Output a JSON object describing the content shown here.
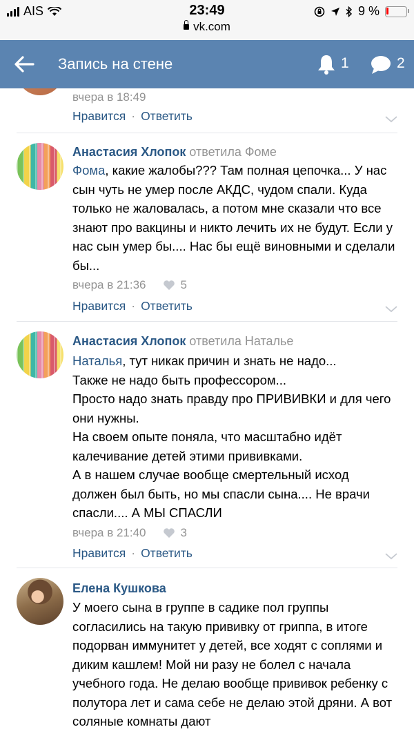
{
  "status": {
    "carrier": "AIS",
    "time": "23:49",
    "url": "vk.com",
    "battery": "9 %"
  },
  "header": {
    "title": "Запись на стене",
    "notifications_count": "1",
    "messages_count": "2"
  },
  "comments": [
    {
      "date": "вчера в 18:49",
      "like_label": "Нравится",
      "reply_label": "Ответить"
    },
    {
      "author": "Анастасия Хлопок",
      "reply_to": "ответила Фоме",
      "mention": "Фома",
      "text": ", какие жалобы??? Там полная цепочка... У нас сын чуть не умер после АКДС, чудом спали. Куда только не жаловалась, а потом мне сказали что все знают про вакцины и никто лечить их не будут. Если у нас сын умер бы.... Нас бы ещё виновными и сделали бы...",
      "date": "вчера в 21:36",
      "likes": "5",
      "like_label": "Нравится",
      "reply_label": "Ответить"
    },
    {
      "author": "Анастасия Хлопок",
      "reply_to": "ответила Наталье",
      "mention": "Наталья",
      "text_lines": [
        ", тут никак причин и знать не надо...",
        "Также не надо быть профессором...",
        "Просто надо знать правду про ПРИВИВКИ и для чего они нужны.",
        "На своем опыте поняла, что масштабно идёт калечивание детей этими прививками.",
        "А в нашем случае вообще смертельный исход должен был быть, но мы спасли сына.... Не врачи спасли.... А МЫ СПАСЛИ"
      ],
      "date": "вчера в 21:40",
      "likes": "3",
      "like_label": "Нравится",
      "reply_label": "Ответить"
    },
    {
      "author": "Елена Кушкова",
      "text": "У моего сына в группе в садике пол группы согласились на такую прививку от гриппа, в итоге подорван иммунитет у детей, все ходят с соплями и диким кашлем! Мой ни разу не болел с начала учебного года. Не делаю вообще прививок ребенку с полутора лет и сама себе не делаю этой дряни. А вот соляные комнаты дают"
    }
  ],
  "colors": {
    "header_bg": "#5b84b1",
    "link": "#2a5885",
    "muted": "#939393"
  }
}
